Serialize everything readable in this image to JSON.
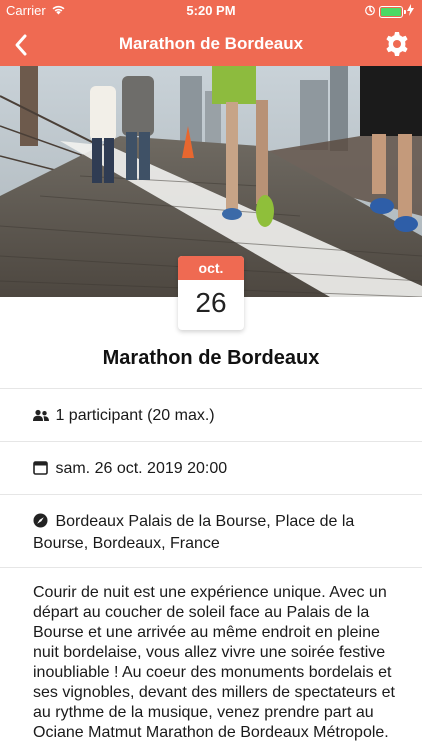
{
  "status_bar": {
    "carrier": "Carrier",
    "time": "5:20 PM",
    "battery_color": "#4cd964"
  },
  "nav": {
    "title": "Marathon de Bordeaux",
    "back_icon": "chevron-left-icon",
    "settings_icon": "gear-icon",
    "color": "#ef6a52"
  },
  "event": {
    "month": "oct.",
    "day": "26",
    "title": "Marathon de Bordeaux",
    "participants": "1 participant (20 max.)",
    "datetime": "sam. 26 oct. 2019 20:00",
    "location": "Bordeaux Palais de la Bourse, Place de la Bourse, Bordeaux, France",
    "description": "Courir de nuit est une expérience unique. Avec un départ au coucher de soleil face au Palais de la Bourse et une arrivée au même endroit en pleine nuit bordelaise, vous allez vivre une soirée festive inoubliable ! Au coeur des monuments bordelais et ses vignobles, devant des millers de spectateurs et au rythme de la musique, venez prendre part au Ociane Matmut Marathon de Bordeaux Métropole."
  }
}
